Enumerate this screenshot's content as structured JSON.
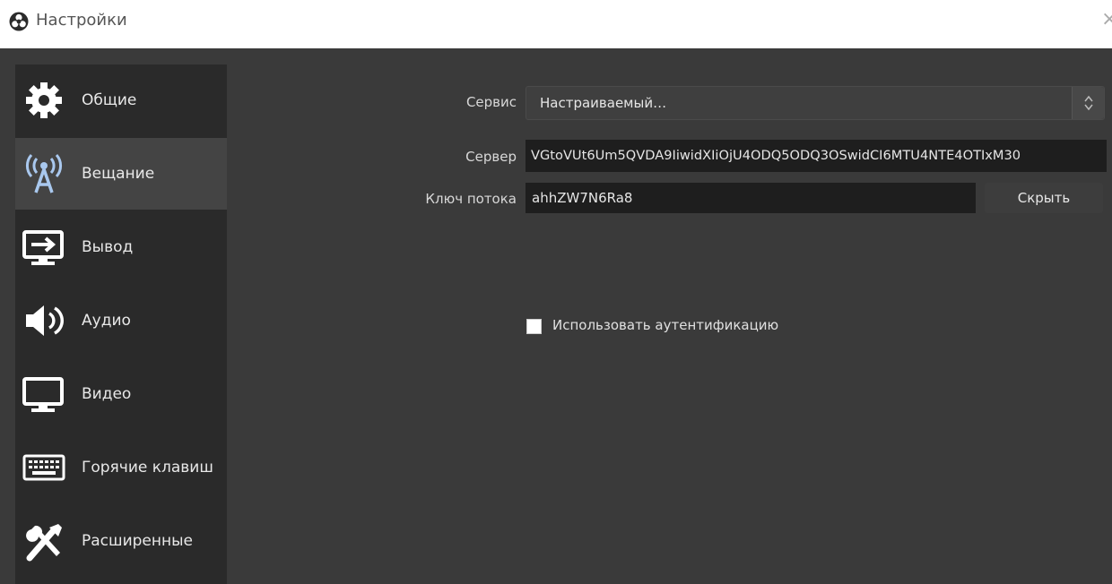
{
  "window": {
    "title": "Настройки",
    "app_icon": "obs-logo-icon",
    "close_icon": "close-icon"
  },
  "sidebar": {
    "items": [
      {
        "label": "Общие",
        "icon": "gear-icon",
        "active": false
      },
      {
        "label": "Вещание",
        "icon": "broadcast-antenna-icon",
        "active": true
      },
      {
        "label": "Вывод",
        "icon": "monitor-output-icon",
        "active": false
      },
      {
        "label": "Аудио",
        "icon": "speaker-icon",
        "active": false
      },
      {
        "label": "Видео",
        "icon": "monitor-icon",
        "active": false
      },
      {
        "label": "Горячие клавиш",
        "icon": "keyboard-icon",
        "active": false
      },
      {
        "label": "Расширенные",
        "icon": "tools-icon",
        "active": false
      }
    ]
  },
  "stream": {
    "service_label": "Сервис",
    "service_value": "Настраиваемый…",
    "server_label": "Сервер",
    "server_value": "VGtoVUt6Um5QVDA9IiwidXIiOjU4ODQ5ODQ3OSwidCI6MTU4NTE4OTIxM30",
    "key_label": "Ключ потока",
    "key_value": "ahhZW7N6Ra8",
    "hide_button": "Скрыть",
    "auth_checkbox_label": "Использовать аутентификацию",
    "auth_checked": false
  },
  "colors": {
    "window_bg": "#3a3a3a",
    "sidebar_bg": "#2a2a2a",
    "active_item_bg": "#444444",
    "field_bg": "#1e1e1e"
  }
}
